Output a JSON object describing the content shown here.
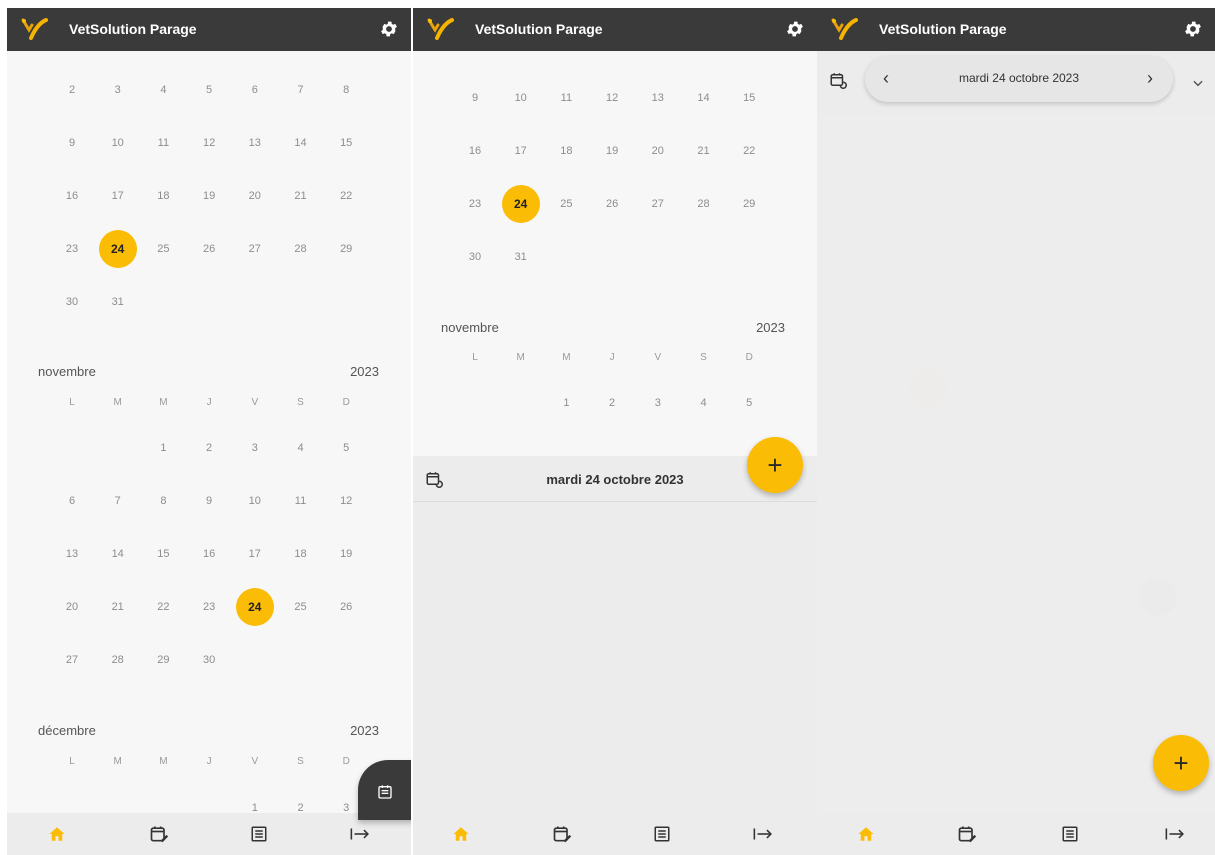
{
  "app": {
    "title": "VetSolution Parage"
  },
  "weekdays": [
    "L",
    "M",
    "M",
    "J",
    "V",
    "S",
    "D"
  ],
  "panel1": {
    "october_weeks": [
      [
        "2",
        "3",
        "4",
        "5",
        "6",
        "7",
        "8"
      ],
      [
        "9",
        "10",
        "11",
        "12",
        "13",
        "14",
        "15"
      ],
      [
        "16",
        "17",
        "18",
        "19",
        "20",
        "21",
        "22"
      ],
      [
        "23",
        "24",
        "25",
        "26",
        "27",
        "28",
        "29"
      ],
      [
        "30",
        "31",
        "",
        "",
        "",
        "",
        ""
      ]
    ],
    "november": {
      "month": "novembre",
      "year": "2023",
      "weeks": [
        [
          "",
          "",
          "1",
          "2",
          "3",
          "4",
          "5"
        ],
        [
          "6",
          "7",
          "8",
          "9",
          "10",
          "11",
          "12"
        ],
        [
          "13",
          "14",
          "15",
          "16",
          "17",
          "18",
          "19"
        ],
        [
          "20",
          "21",
          "22",
          "23",
          "24",
          "25",
          "26"
        ],
        [
          "27",
          "28",
          "29",
          "30",
          "",
          "",
          ""
        ]
      ]
    },
    "december": {
      "month": "décembre",
      "year": "2023",
      "weeks": [
        [
          "",
          "",
          "",
          "",
          "1",
          "2",
          "3"
        ]
      ]
    }
  },
  "panel2": {
    "october_weeks": [
      [
        "9",
        "10",
        "11",
        "12",
        "13",
        "14",
        "15"
      ],
      [
        "16",
        "17",
        "18",
        "19",
        "20",
        "21",
        "22"
      ],
      [
        "23",
        "24",
        "25",
        "26",
        "27",
        "28",
        "29"
      ],
      [
        "30",
        "31",
        "",
        "",
        "",
        "",
        ""
      ]
    ],
    "november": {
      "month": "novembre",
      "year": "2023",
      "weeks": [
        [
          "",
          "",
          "1",
          "2",
          "3",
          "4",
          "5"
        ]
      ]
    },
    "selected_date": "mardi 24 octobre 2023",
    "fab_label": "+"
  },
  "panel3": {
    "selected_date": "mardi 24 octobre 2023",
    "prev_label": "‹",
    "next_label": "›",
    "fab_label": "+"
  },
  "today": "24",
  "colors": {
    "accent": "#fbbc05",
    "appbar": "#3a3a3a",
    "background": "#f8f7f8",
    "nav": "#ececec"
  },
  "nav_items": [
    "home-icon",
    "calendar-edit-icon",
    "list-icon",
    "logout-icon"
  ]
}
